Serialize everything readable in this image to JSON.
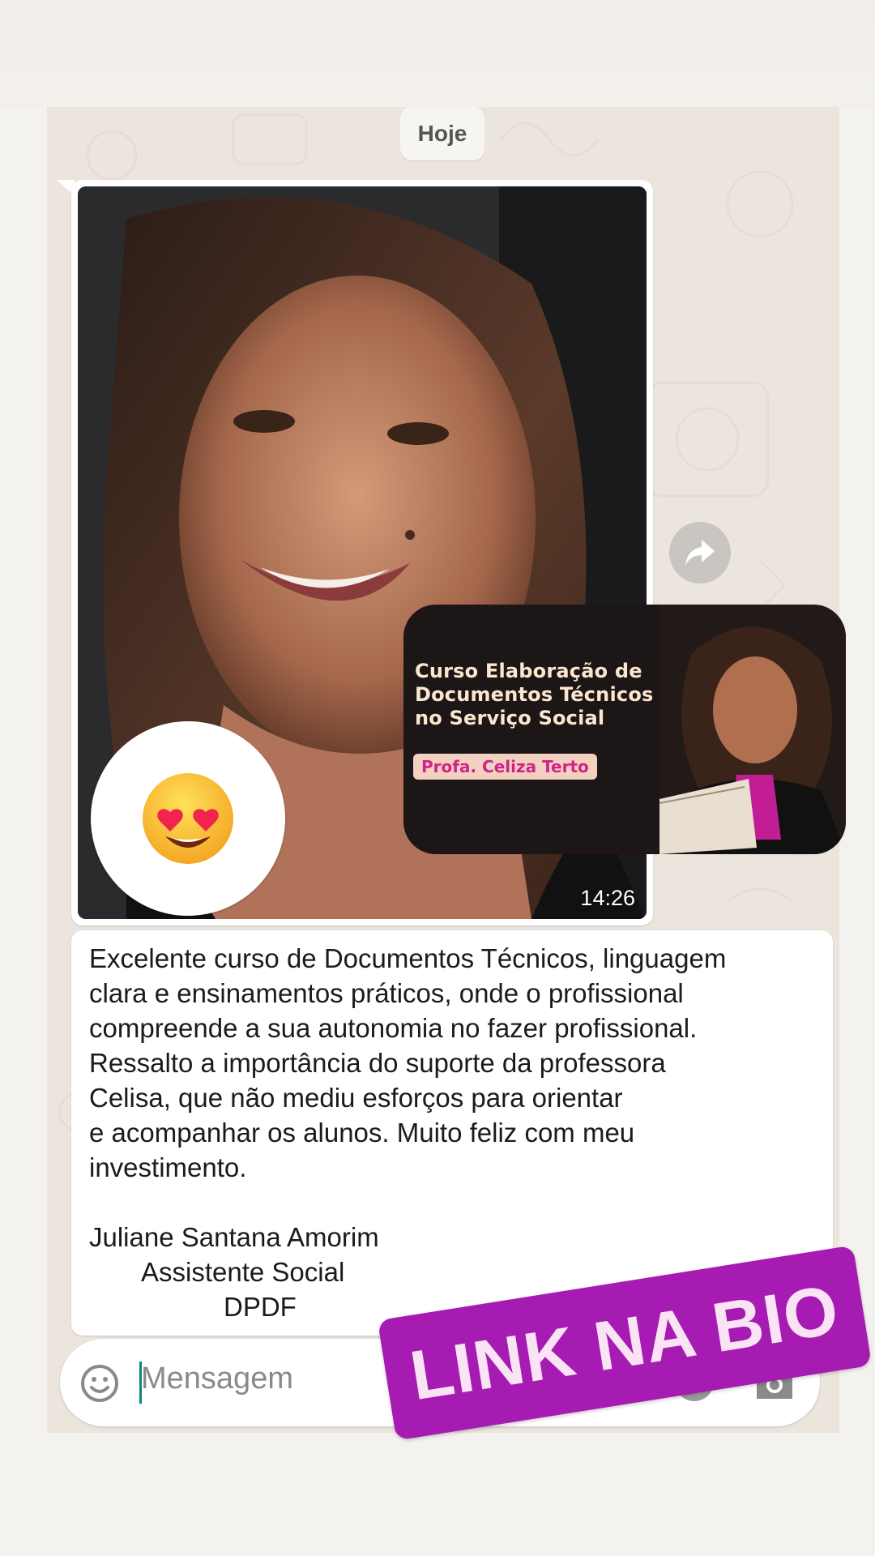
{
  "chat": {
    "date_label": "Hoje",
    "image_message": {
      "timestamp": "14:26",
      "reaction": "heart-eyes emoji"
    }
  },
  "course_card": {
    "title_lines": [
      "Curso Elaboração de",
      "Documentos Técnicos",
      "no Serviço Social"
    ],
    "instructor_tag": "Profa. Celiza Terto"
  },
  "text_message": {
    "lines": [
      "Excelente curso de Documentos Técnicos, linguagem",
      "clara e ensinamentos práticos, onde o profissional",
      "compreende a sua autonomia no fazer profissional.",
      "Ressalto a importância do suporte da professora",
      "Celisa, que não mediu esforços para orientar",
      "e acompanhar os alunos. Muito feliz com meu",
      "investimento."
    ],
    "signature": {
      "name": "Juliane Santana Amorim",
      "role": "Assistente Social",
      "location": "DPDF"
    }
  },
  "composer": {
    "placeholder": "Mensagem",
    "pay_icon_label": "R$"
  },
  "banner": {
    "text": "LINK NA BIO"
  },
  "colors": {
    "chat_background": "#ece5dd",
    "bubble": "#ffffff",
    "banner": "#a61cb3",
    "course_card_bg": "#1c1616",
    "course_tag_text": "#d02488"
  },
  "icons": [
    "forward-icon",
    "emoji-icon",
    "payment-icon",
    "camera-icon",
    "heart-eyes-emoji"
  ]
}
